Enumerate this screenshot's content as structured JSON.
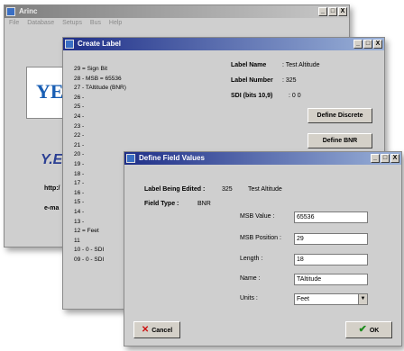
{
  "arinc_window": {
    "title": "Arinc",
    "menu": [
      "File",
      "Database",
      "Setups",
      "Bus",
      "Help"
    ],
    "logo_text": "YE",
    "logo_text2": "Y.E",
    "http_label": "http:/",
    "email_label": "e-ma"
  },
  "create_label_window": {
    "title": "Create Label",
    "bit_items": [
      "29 = Sign Bit",
      "28 - MSB = 65536",
      "27 - TAltitude (BNR)",
      "26 -",
      "25 -",
      "24 -",
      "23 -",
      "22 -",
      "21 -",
      "20 -",
      "19 -",
      "18 -",
      "17 -",
      "16 -",
      "15 -",
      "14 -",
      "13 -",
      "12 = Feet",
      "11",
      "10 - 0 - SDI",
      "09 - 0 - SDI"
    ],
    "label_name_caption": "Label Name",
    "label_name_value": ":  Test Altitude",
    "label_number_caption": "Label Number",
    "label_number_value": ":  325",
    "sdi_caption": "SDI (bits 10,9)",
    "sdi_value": ":  0 0",
    "define_discrete_button": "Define Discrete",
    "define_bnr_button": "Define BNR"
  },
  "define_field_window": {
    "title": "Define Field Values",
    "label_being_edited_caption": "Label Being Edited :",
    "label_being_edited_number": "325",
    "label_being_edited_name": "Test Altitude",
    "field_type_caption": "Field Type :",
    "field_type_value": "BNR",
    "msb_value_label": "MSB Value :",
    "msb_value": "65536",
    "msb_position_label": "MSB Position :",
    "msb_position": "29",
    "length_label": "Length :",
    "length": "18",
    "name_label": "Name :",
    "name": "TAltitude",
    "units_label": "Units :",
    "units_selected": "Feet",
    "cancel_button": "Cancel",
    "ok_button": "OK"
  },
  "title_buttons": {
    "minimize": "_",
    "maximize": "□",
    "close": "X"
  },
  "colors": {
    "title_active": "#1f2f88",
    "window_bg": "#cfcfcf",
    "cancel_icon": "#cc1111",
    "ok_icon": "#1a8a1a"
  }
}
